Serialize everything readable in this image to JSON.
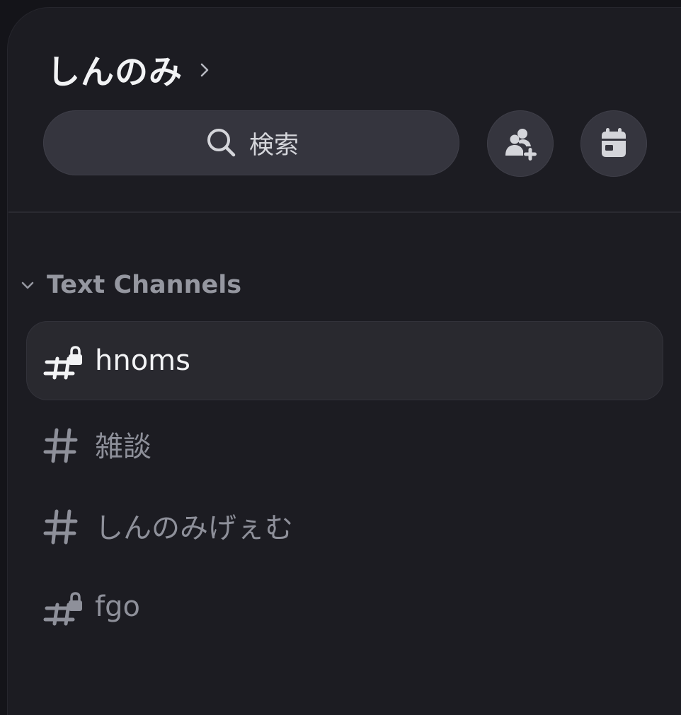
{
  "server": {
    "name": "しんのみ"
  },
  "search": {
    "label": "検索"
  },
  "actions": {
    "invite_icon": "person-add-icon",
    "events_icon": "calendar-icon"
  },
  "category": {
    "label": "Text Channels",
    "icon": "chevron-down-icon"
  },
  "channels": [
    {
      "name": "hnoms",
      "icon": "hash-lock-icon",
      "selected": true
    },
    {
      "name": "雑談",
      "icon": "hash-icon",
      "selected": false
    },
    {
      "name": "しんのみげぇむ",
      "icon": "hash-icon",
      "selected": false
    },
    {
      "name": "fgo",
      "icon": "hash-lock-icon",
      "selected": false
    }
  ],
  "colors": {
    "background": "#1c1c22",
    "selected_channel_bg": "#29292f",
    "button_bg": "#35353e",
    "text_primary": "#f2f3f5",
    "text_muted": "#8e909a"
  }
}
